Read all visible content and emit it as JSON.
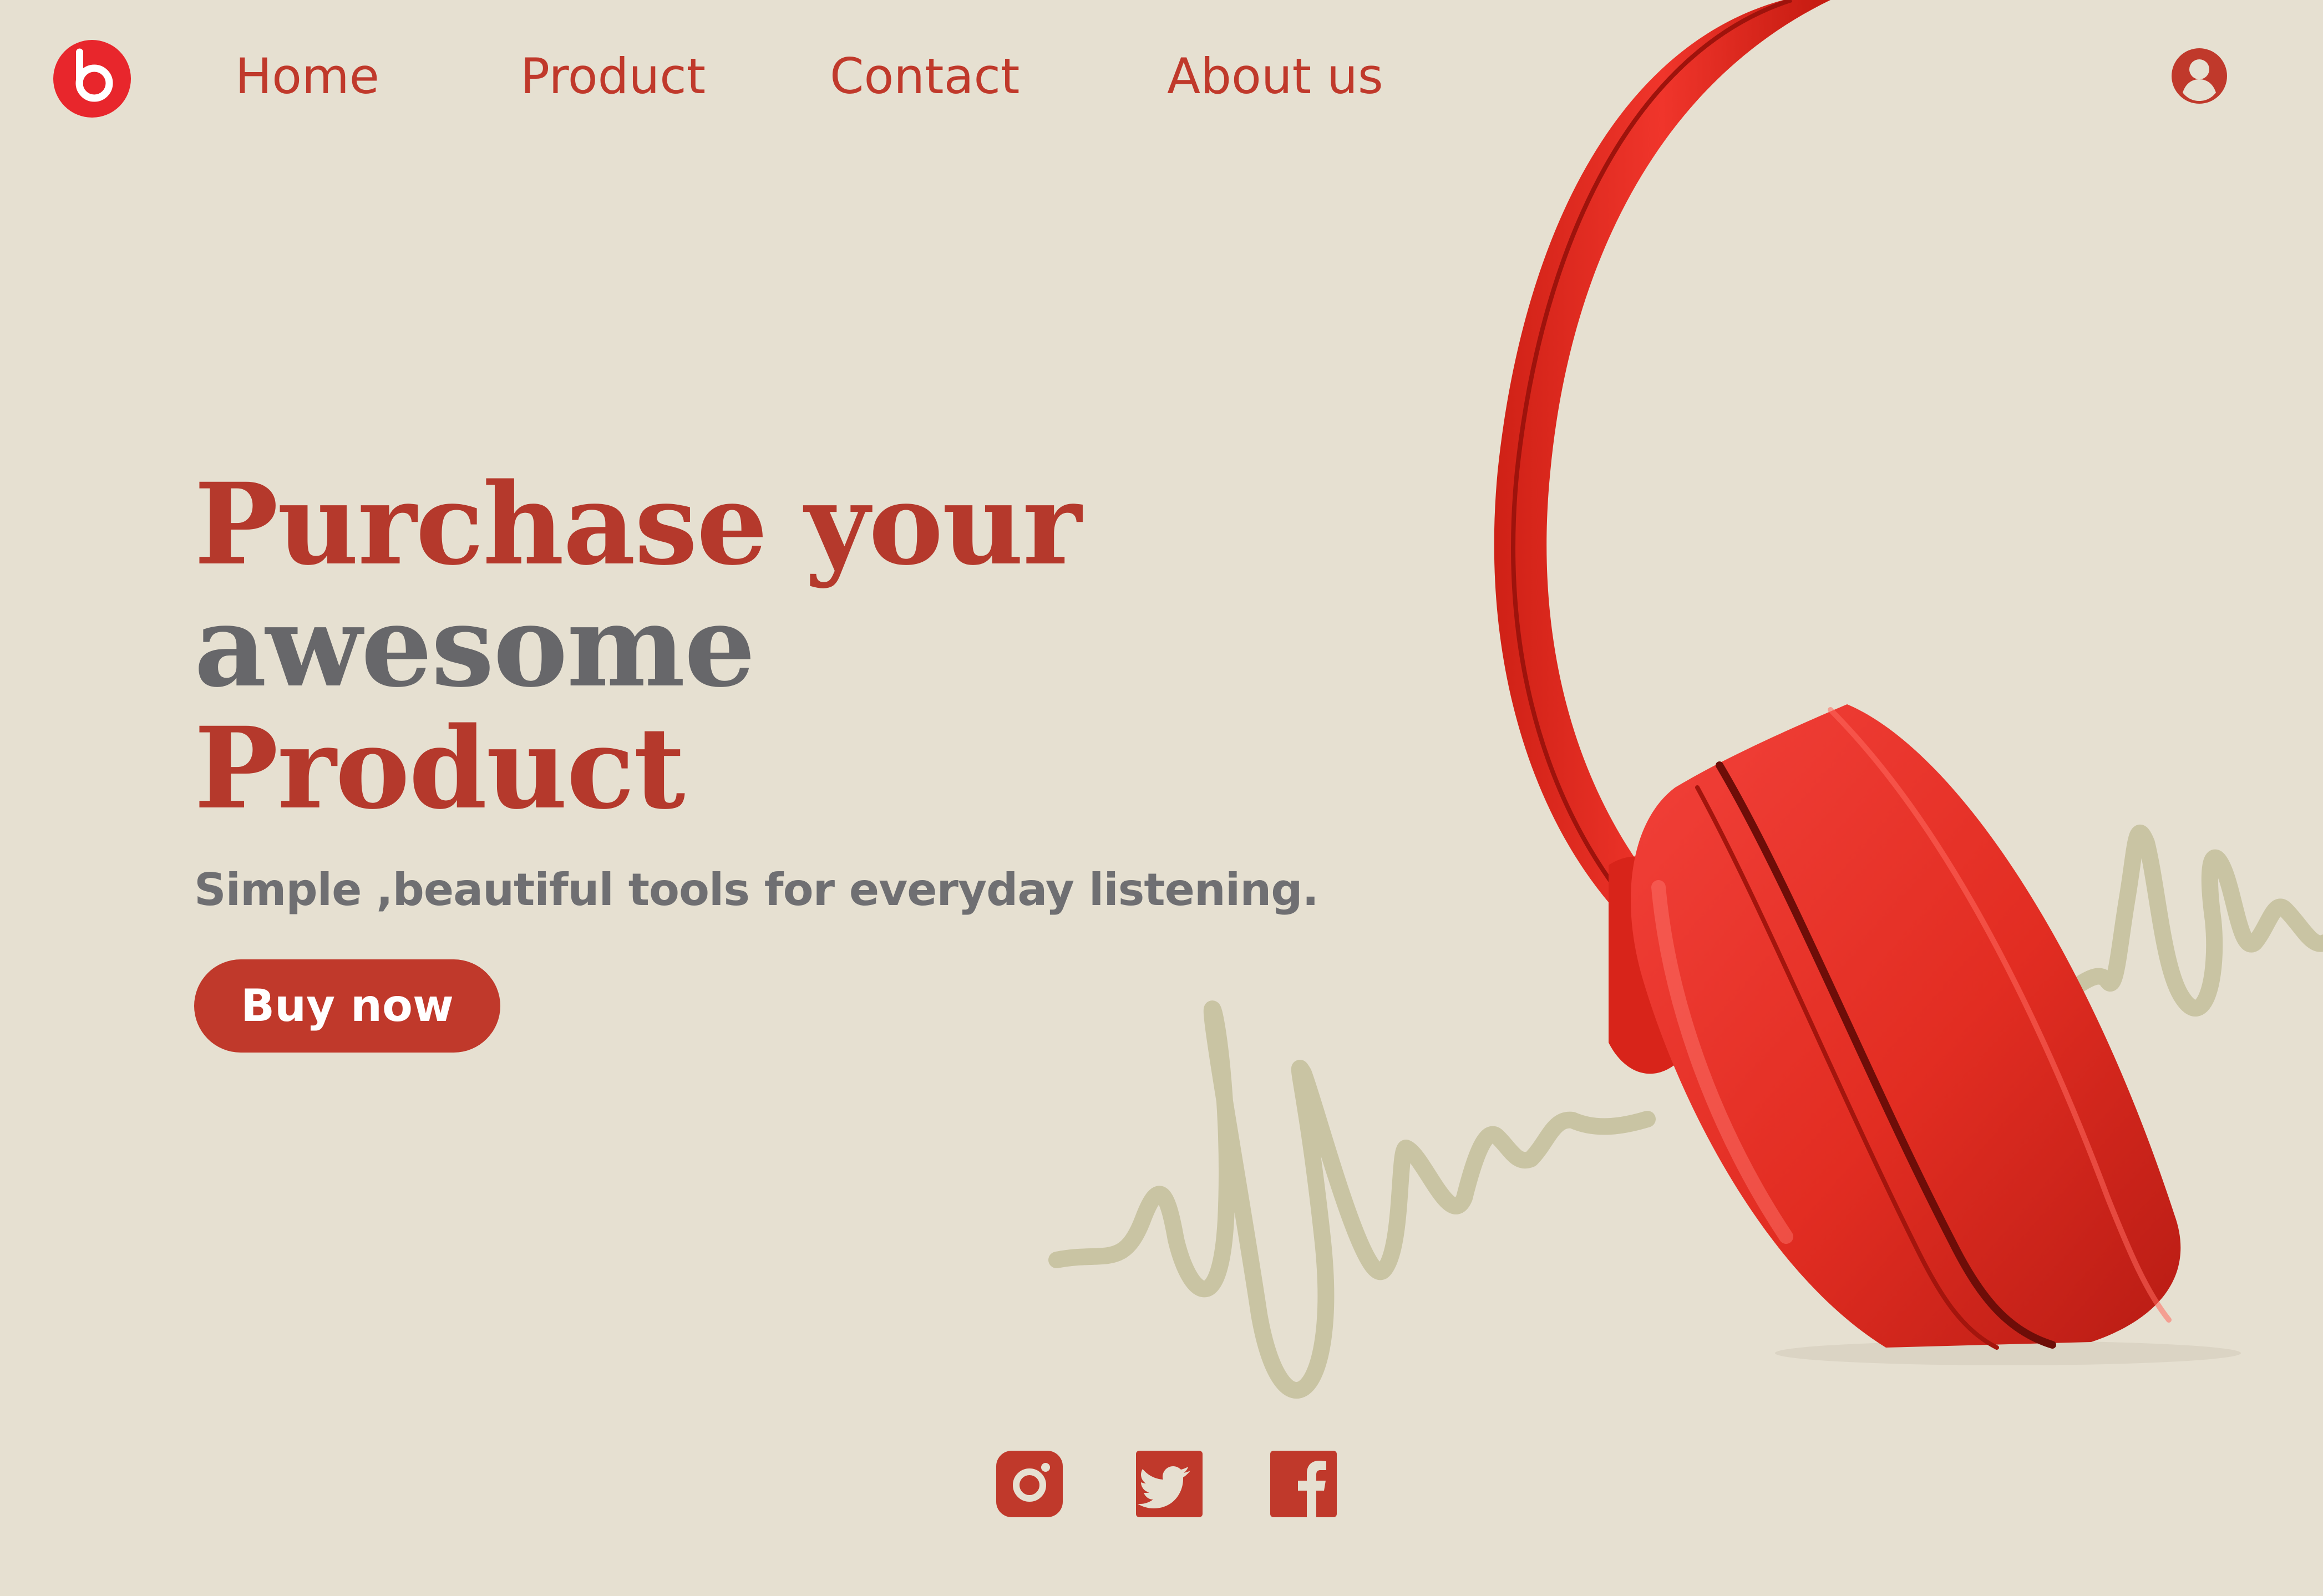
{
  "brand": {
    "logo_icon": "beats-logo-icon",
    "accent_color": "#c0392b",
    "background_color": "#e6e0d1",
    "title_gray": "#67676a",
    "wave_color": "#c9c4a3"
  },
  "nav": {
    "items": [
      {
        "label": "Home"
      },
      {
        "label": "Product"
      },
      {
        "label": "Contact"
      },
      {
        "label": "About us"
      }
    ],
    "account_icon": "user-account-icon"
  },
  "hero": {
    "title_line1": "Purchase your",
    "title_line2": "awesome",
    "title_line3": "Product",
    "tagline": "Simple ,beautiful tools for everyday listening.",
    "cta_label": "Buy now",
    "image_icon": "red-headphones-image",
    "decoration_icon": "sound-wave-decoration"
  },
  "social": {
    "items": [
      {
        "icon": "instagram-icon"
      },
      {
        "icon": "twitter-icon"
      },
      {
        "icon": "facebook-icon"
      }
    ]
  }
}
